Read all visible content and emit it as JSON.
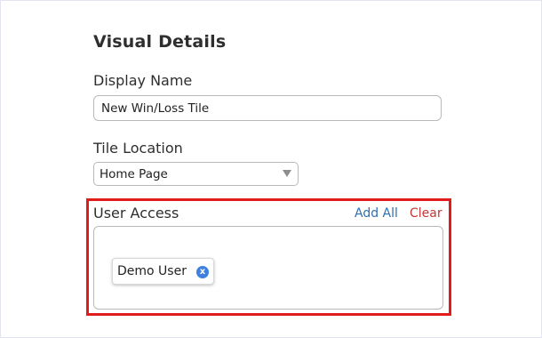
{
  "visual_details": {
    "title": "Visual Details",
    "display_name": {
      "label": "Display Name",
      "value": "New Win/Loss Tile"
    },
    "tile_location": {
      "label": "Tile Location",
      "selected": "Home Page"
    },
    "user_access": {
      "label": "User Access",
      "add_all_label": "Add All",
      "clear_label": "Clear",
      "users": [
        {
          "name": "Demo User",
          "remove_icon": "x"
        }
      ]
    }
  },
  "colors": {
    "link_blue": "#2f6fb0",
    "clear_red": "#c93636",
    "highlight_red": "#e21b1b",
    "chip_remove_blue": "#3d80e0"
  }
}
